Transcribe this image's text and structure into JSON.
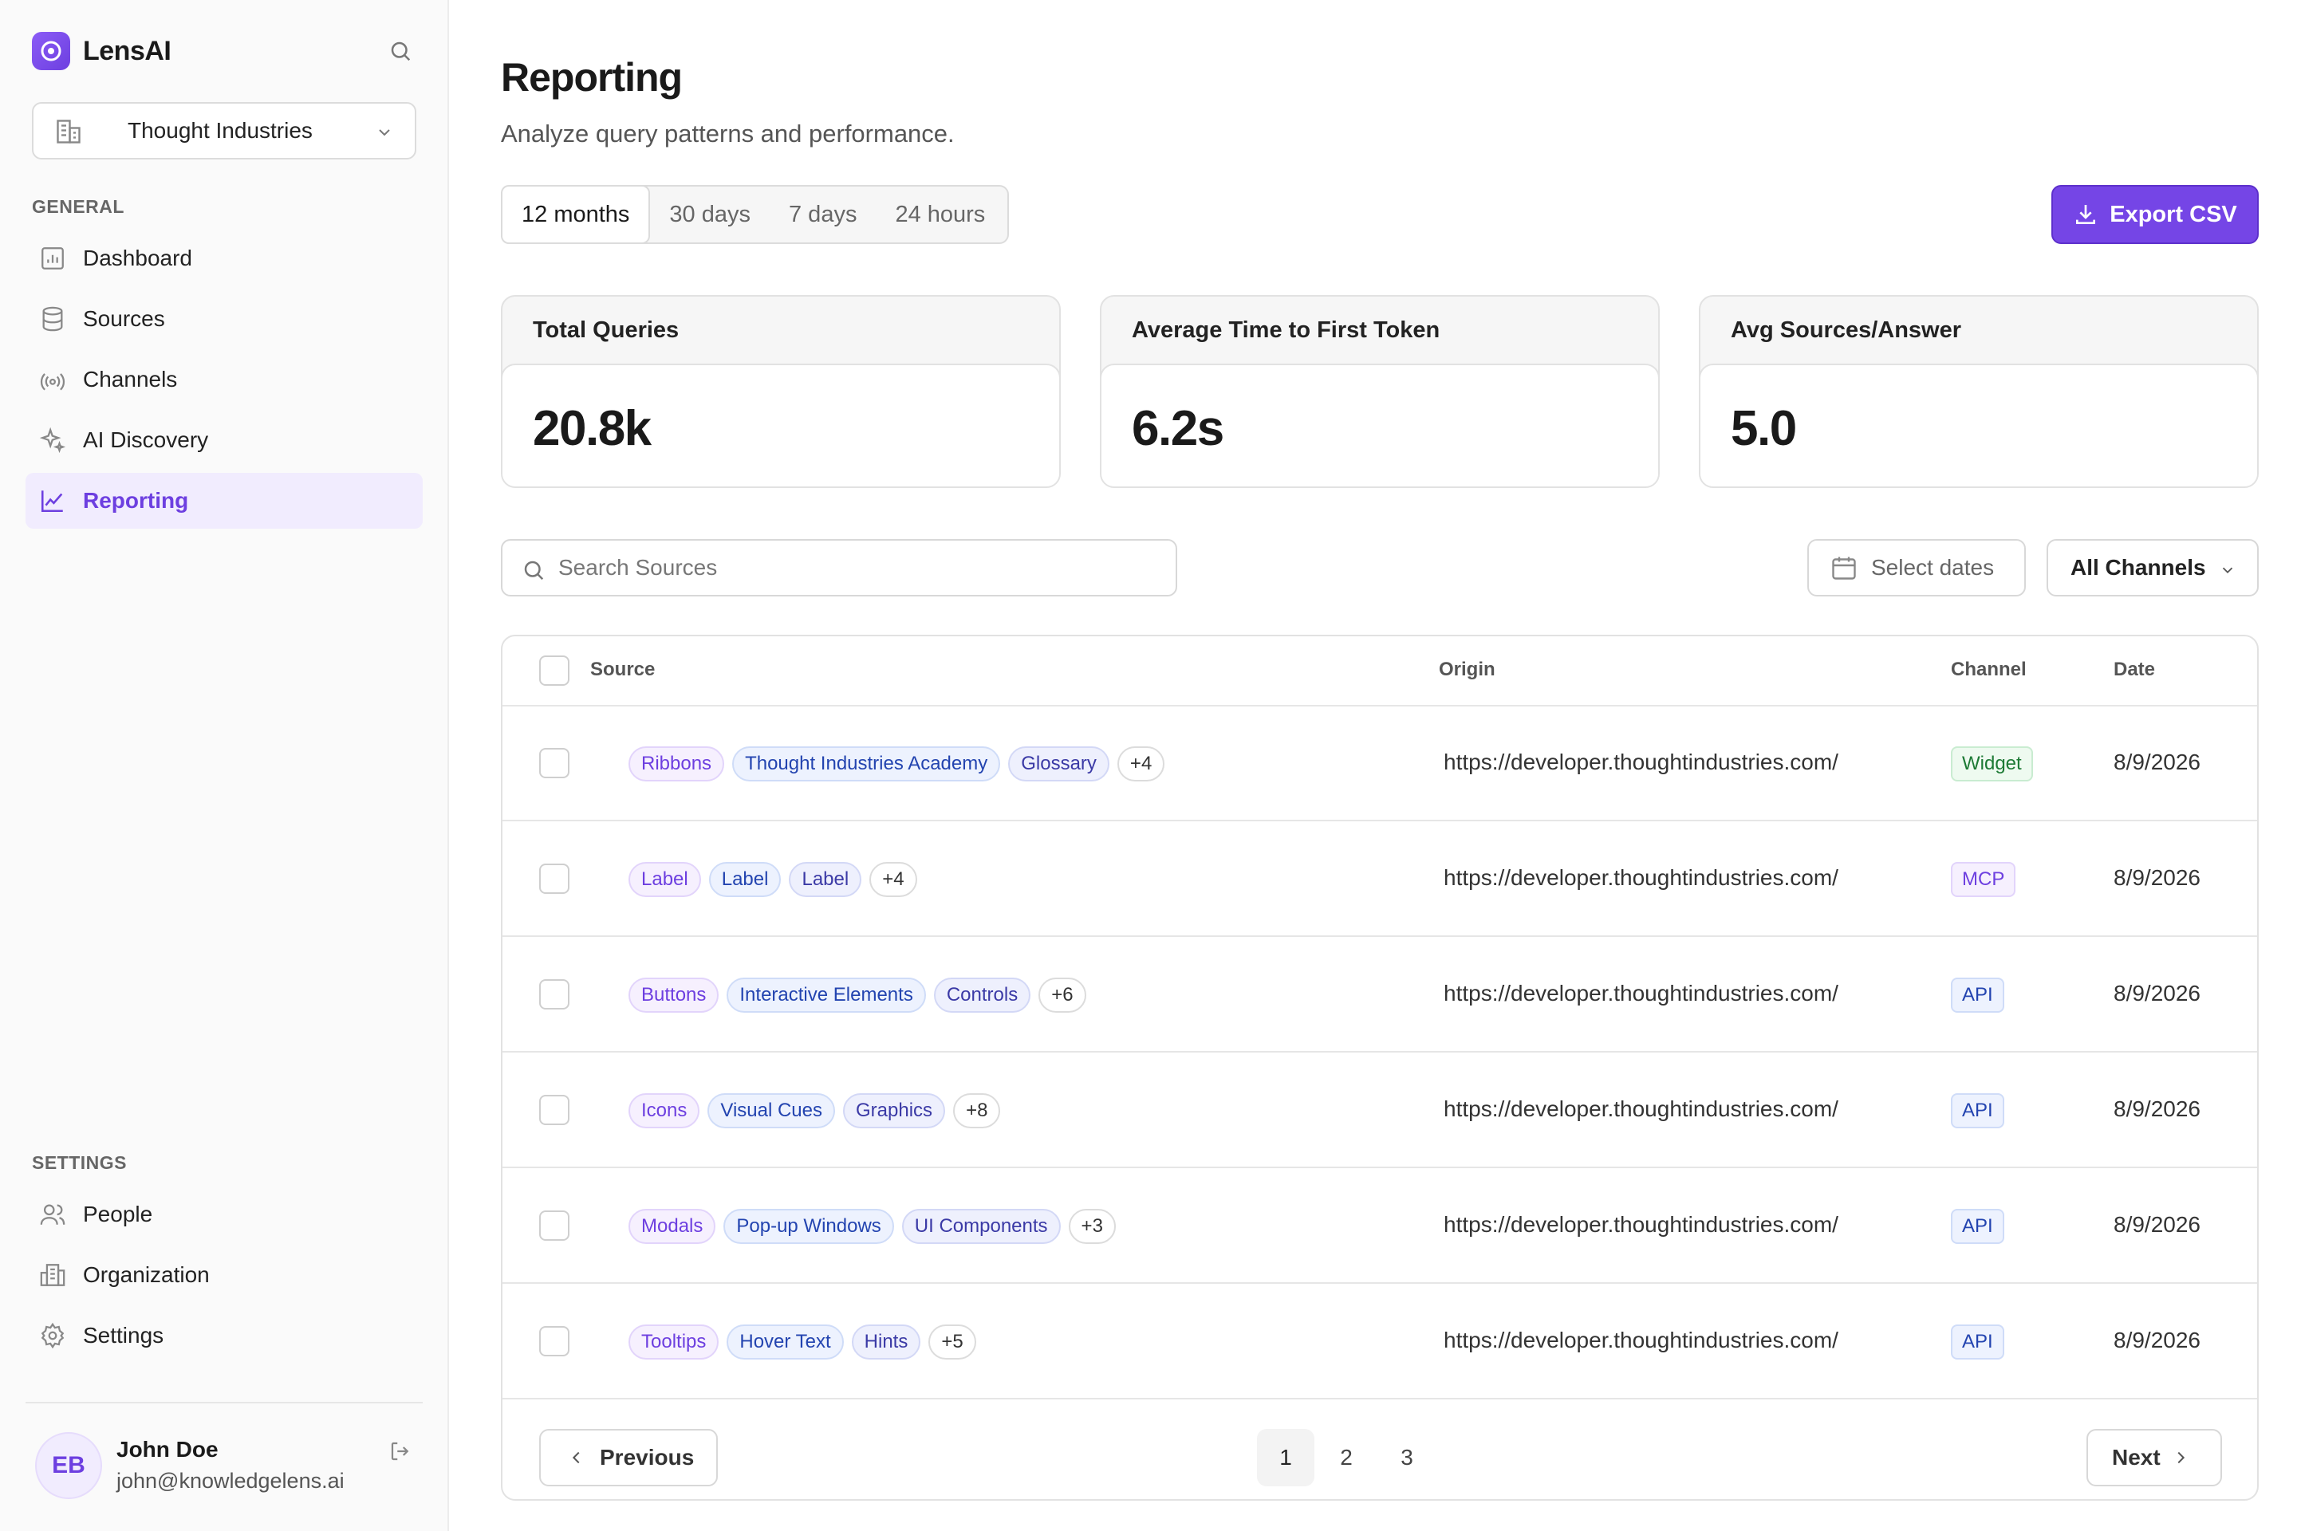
{
  "brand": {
    "name": "LensAI"
  },
  "org": {
    "name": "Thought Industries"
  },
  "sidebar": {
    "general_label": "GENERAL",
    "general": [
      {
        "label": "Dashboard",
        "icon": "dashboard-icon"
      },
      {
        "label": "Sources",
        "icon": "database-icon"
      },
      {
        "label": "Channels",
        "icon": "broadcast-icon"
      },
      {
        "label": "AI Discovery",
        "icon": "sparkles-icon"
      },
      {
        "label": "Reporting",
        "icon": "line-chart-icon",
        "active": true
      }
    ],
    "settings_label": "SETTINGS",
    "settings": [
      {
        "label": "People",
        "icon": "people-icon"
      },
      {
        "label": "Organization",
        "icon": "building-icon"
      },
      {
        "label": "Settings",
        "icon": "gear-icon"
      }
    ]
  },
  "user": {
    "initials": "EB",
    "name": "John Doe",
    "email": "john@knowledgelens.ai"
  },
  "header": {
    "title": "Reporting",
    "subtitle": "Analyze query patterns and performance."
  },
  "ranges": [
    "12 months",
    "30 days",
    "7 days",
    "24 hours"
  ],
  "export_label": "Export CSV",
  "stats": [
    {
      "label": "Total Queries",
      "value": "20.8k"
    },
    {
      "label": "Average Time to First Token",
      "value": "6.2s"
    },
    {
      "label": "Avg Sources/Answer",
      "value": "5.0"
    }
  ],
  "filters": {
    "search_placeholder": "Search Sources",
    "date_label": "Select dates",
    "channel_label": "All Channels"
  },
  "table": {
    "headers": {
      "source": "Source",
      "origin": "Origin",
      "channel": "Channel",
      "date": "Date"
    },
    "rows": [
      {
        "tags": [
          "Ribbons",
          "Thought Industries Academy",
          "Glossary"
        ],
        "more": "+4",
        "origin": "https://developer.thoughtindustries.com/",
        "channel": "Widget",
        "date": "8/9/2026"
      },
      {
        "tags": [
          "Label",
          "Label",
          "Label"
        ],
        "more": "+4",
        "origin": "https://developer.thoughtindustries.com/",
        "channel": "MCP",
        "date": "8/9/2026"
      },
      {
        "tags": [
          "Buttons",
          "Interactive Elements",
          "Controls"
        ],
        "more": "+6",
        "origin": "https://developer.thoughtindustries.com/",
        "channel": "API",
        "date": "8/9/2026"
      },
      {
        "tags": [
          "Icons",
          "Visual Cues",
          "Graphics"
        ],
        "more": "+8",
        "origin": "https://developer.thoughtindustries.com/",
        "channel": "API",
        "date": "8/9/2026"
      },
      {
        "tags": [
          "Modals",
          "Pop-up Windows",
          "UI Components"
        ],
        "more": "+3",
        "origin": "https://developer.thoughtindustries.com/",
        "channel": "API",
        "date": "8/9/2026"
      },
      {
        "tags": [
          "Tooltips",
          "Hover Text",
          "Hints"
        ],
        "more": "+5",
        "origin": "https://developer.thoughtindustries.com/",
        "channel": "API",
        "date": "8/9/2026"
      }
    ]
  },
  "pagination": {
    "prev": "Previous",
    "next": "Next",
    "pages": [
      "1",
      "2",
      "3"
    ],
    "current": "1"
  },
  "colors": {
    "accent": "#7545e6",
    "accent_soft": "#f1ecfe"
  }
}
